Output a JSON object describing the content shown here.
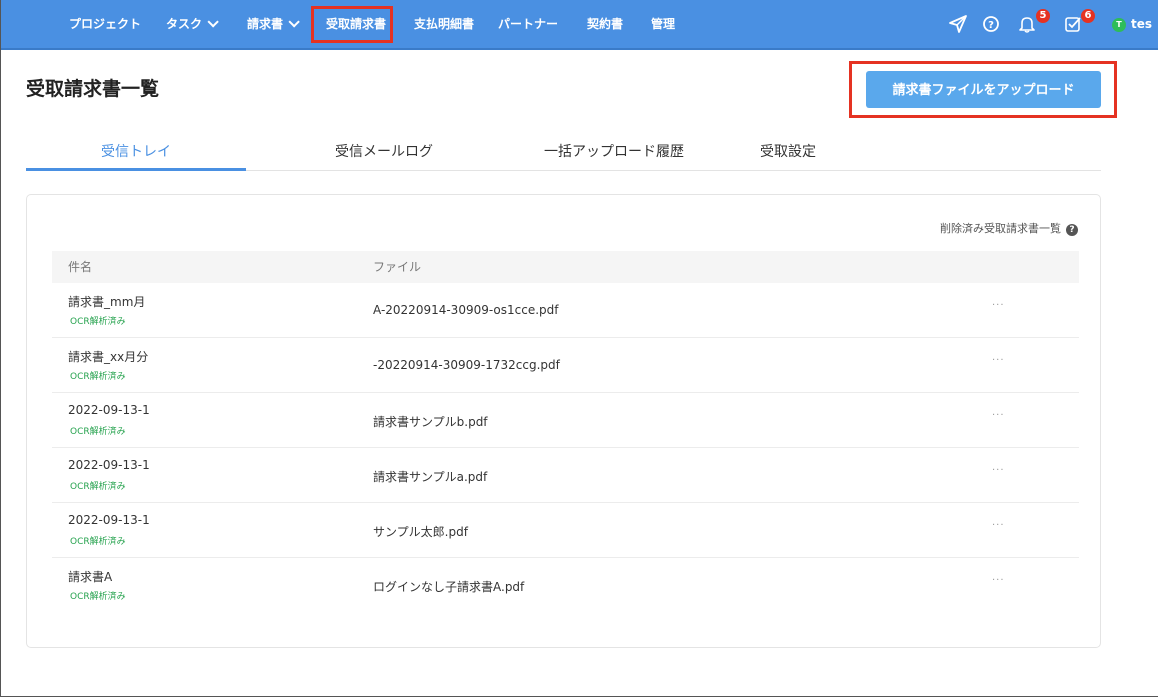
{
  "nav": {
    "items": [
      {
        "label": "プロジェクト",
        "dropdown": false
      },
      {
        "label": "タスク",
        "dropdown": true
      },
      {
        "label": "請求書",
        "dropdown": true
      },
      {
        "label": "受取請求書",
        "dropdown": false
      },
      {
        "label": "支払明細書",
        "dropdown": false
      },
      {
        "label": "パートナー",
        "dropdown": false
      },
      {
        "label": "契約書",
        "dropdown": false
      },
      {
        "label": "管理",
        "dropdown": false
      }
    ],
    "notifications_badge": "5",
    "tasks_badge": "6",
    "user_initial": "T",
    "user_name": "tes",
    "colors": {
      "bar": "#4a90e2",
      "highlight": "#e53222",
      "badge": "#e53222",
      "avatar": "#2ebd59"
    }
  },
  "page": {
    "title": "受取請求書一覧",
    "upload_button": "請求書ファイルをアップロード"
  },
  "tabs": [
    {
      "label": "受信トレイ",
      "active": true
    },
    {
      "label": "受信メールログ",
      "active": false
    },
    {
      "label": "一括アップロード履歴",
      "active": false
    },
    {
      "label": "受取設定",
      "active": false
    }
  ],
  "table": {
    "deleted_link": "削除済み受取請求書一覧",
    "columns": [
      "件名",
      "ファイル"
    ],
    "rows": [
      {
        "name": "請求書_mm月",
        "status": "OCR解析済み",
        "file": "A-20220914-30909-os1cce.pdf"
      },
      {
        "name": "請求書_xx月分",
        "status": "OCR解析済み",
        "file": "-20220914-30909-1732ccg.pdf"
      },
      {
        "name": "2022-09-13-1",
        "status": "OCR解析済み",
        "file": "請求書サンプルb.pdf"
      },
      {
        "name": "2022-09-13-1",
        "status": "OCR解析済み",
        "file": "請求書サンプルa.pdf"
      },
      {
        "name": "2022-09-13-1",
        "status": "OCR解析済み",
        "file": "サンプル太郎.pdf"
      },
      {
        "name": "請求書A",
        "status": "OCR解析済み",
        "file": "ログインなし子請求書A.pdf"
      }
    ],
    "more_label": "···"
  }
}
